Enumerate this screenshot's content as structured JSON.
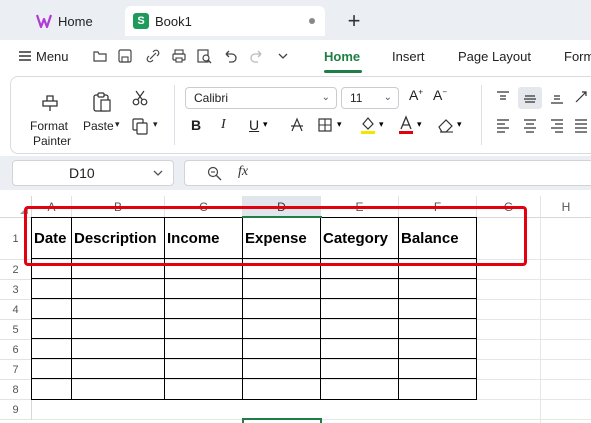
{
  "tabs": {
    "home_label": "Home",
    "book_label": "Book1",
    "book_icon_letter": "S"
  },
  "menu": {
    "menu_label": "Menu",
    "items": [
      "Home",
      "Insert",
      "Page Layout",
      "Form"
    ]
  },
  "ribbon": {
    "format_painter_line1": "Format",
    "format_painter_line2": "Painter",
    "paste_label": "Paste",
    "font_name": "Calibri",
    "font_size": "11",
    "bold": "B",
    "italic": "I",
    "underline": "U"
  },
  "formula_bar": {
    "name_box": "D10",
    "fx_label": "fx"
  },
  "columns": [
    "A",
    "B",
    "C",
    "D",
    "E",
    "F",
    "G",
    "H"
  ],
  "selected_column": "D",
  "rows": [
    "1",
    "2",
    "3",
    "4",
    "5",
    "6",
    "7",
    "8",
    "9"
  ],
  "table_headers": [
    "Date",
    "Description",
    "Income",
    "Expense",
    "Category",
    "Balance"
  ],
  "colors": {
    "accent": "#1e7e45",
    "highlight_box": "#e3000f",
    "sheets_icon": "#1e9a5a"
  }
}
